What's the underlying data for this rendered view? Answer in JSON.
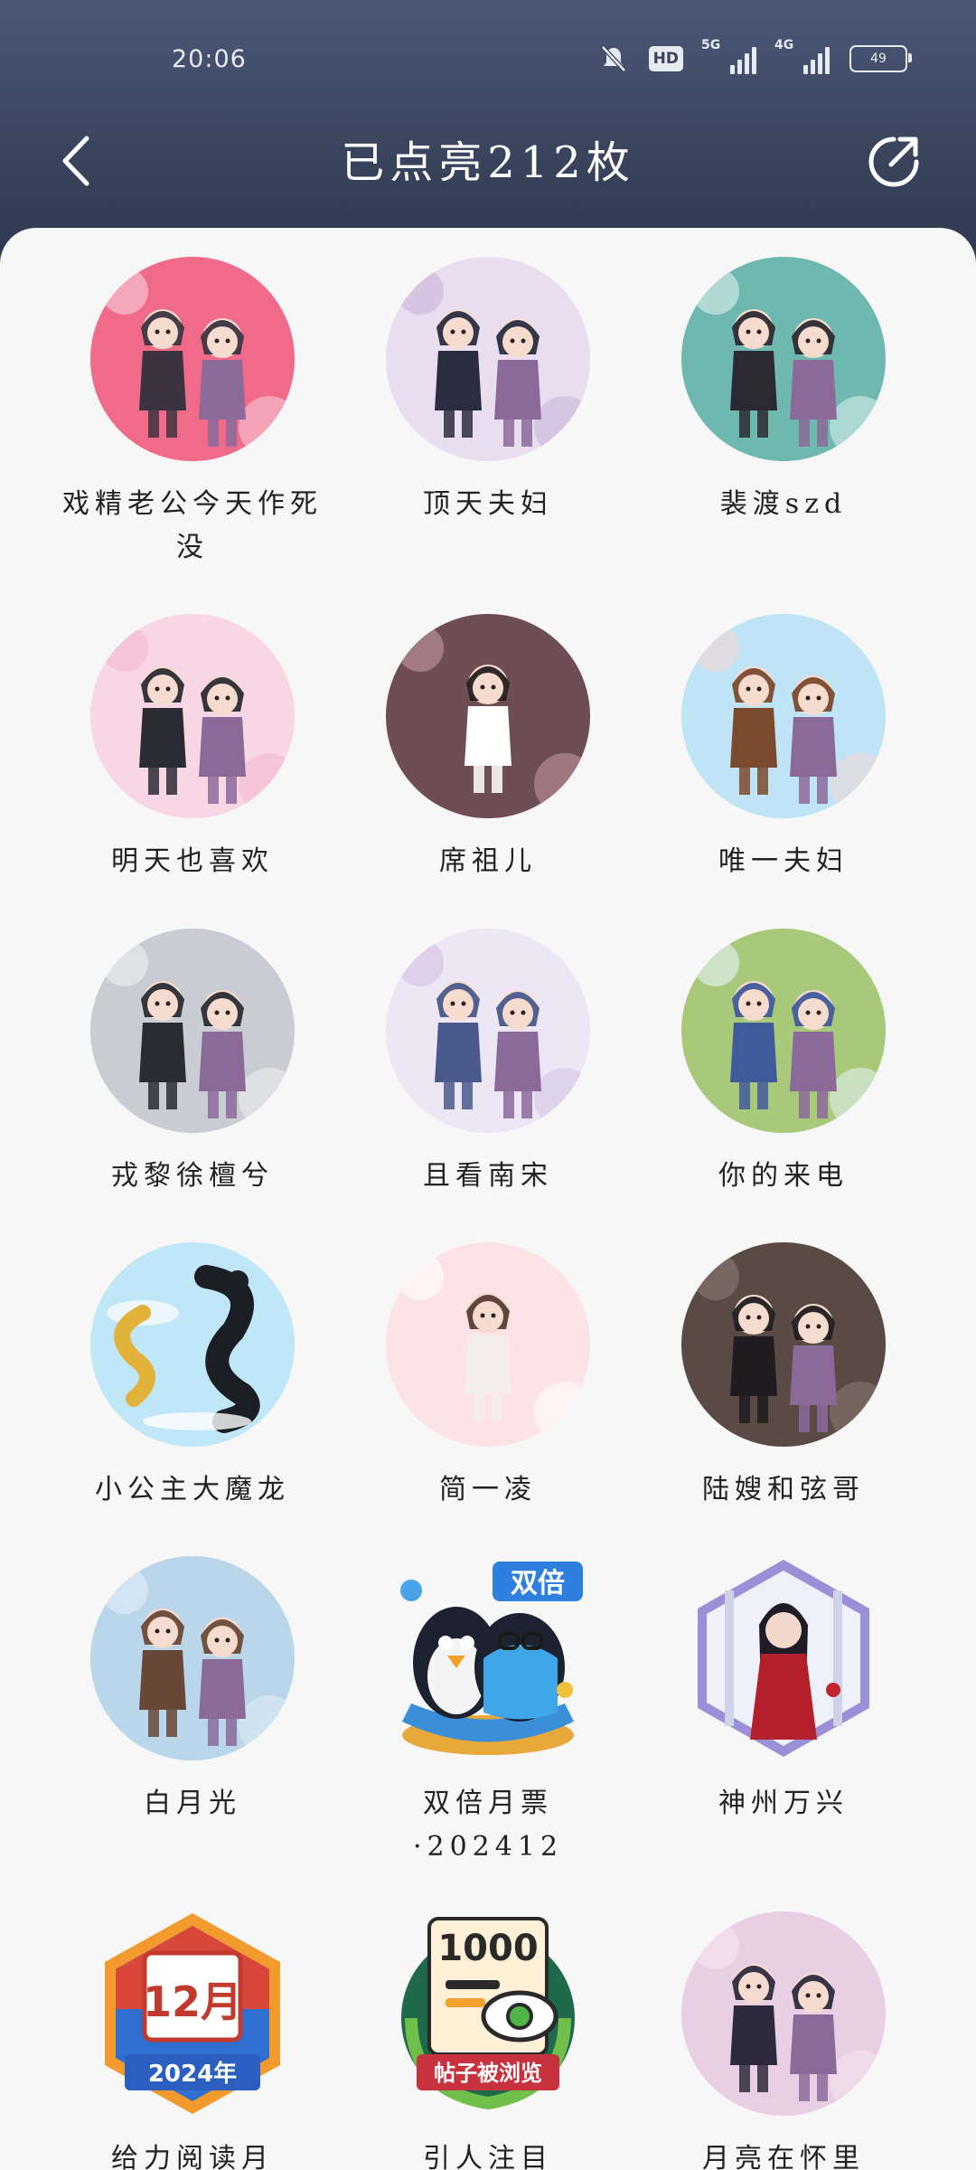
{
  "status_bar": {
    "time": "20:06",
    "battery": "49",
    "network_1": "5G",
    "network_2": "4G",
    "hd": "HD"
  },
  "header": {
    "title": "已点亮212枚"
  },
  "badges": [
    {
      "label": "戏精老公今天作死没",
      "style": "pink",
      "icon": "couple-badge-icon"
    },
    {
      "label": "顶天夫妇",
      "style": "lavender",
      "icon": "couple-badge-icon"
    },
    {
      "label": "裴渡szd",
      "style": "teal",
      "icon": "couple-badge-icon"
    },
    {
      "label": "明天也喜欢",
      "style": "rose",
      "icon": "couple-badge-icon"
    },
    {
      "label": "席祖儿",
      "style": "dusk",
      "icon": "girl-badge-icon"
    },
    {
      "label": "唯一夫妇",
      "style": "sky",
      "icon": "couple-badge-icon"
    },
    {
      "label": "戎黎徐檀兮",
      "style": "grey",
      "icon": "couple-badge-icon"
    },
    {
      "label": "且看南宋",
      "style": "blossom",
      "icon": "couple-badge-icon"
    },
    {
      "label": "你的来电",
      "style": "green",
      "icon": "couple-badge-icon"
    },
    {
      "label": "小公主大魔龙",
      "style": "dragon",
      "icon": "dragon-badge-icon"
    },
    {
      "label": "简一凌",
      "style": "bunny",
      "icon": "girl-badge-icon"
    },
    {
      "label": "陆嫂和弦哥",
      "style": "dark",
      "icon": "couple-badge-icon"
    },
    {
      "label": "白月光",
      "style": "winter",
      "icon": "couple-badge-icon"
    },
    {
      "label": "双倍月票·202412",
      "style": "penguin",
      "icon": "penguin-badge-icon",
      "banner": "双倍"
    },
    {
      "label": "神州万兴",
      "style": "hex",
      "icon": "girl-badge-icon"
    },
    {
      "label": "给力阅读月",
      "style": "calendar",
      "icon": "calendar-badge-icon",
      "top": "12月",
      "bottom": "2024年"
    },
    {
      "label": "引人注目",
      "style": "views",
      "icon": "eye-badge-icon",
      "top": "1000",
      "bottom": "帖子被浏览"
    },
    {
      "label": "月亮在怀里",
      "style": "moon",
      "icon": "couple-badge-icon"
    }
  ]
}
